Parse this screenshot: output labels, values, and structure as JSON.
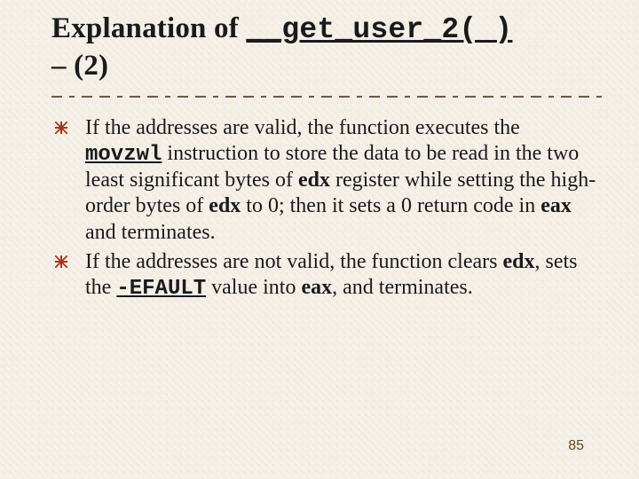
{
  "title": {
    "prefix": "Explanation of ",
    "code": "__get_user_2( )",
    "suffix1": "–",
    "suffix2": "(2)"
  },
  "bullets": [
    {
      "t1": "If the addresses are valid, the function executes the ",
      "code1": "movzwl",
      "t2": " instruction to store the data to be read in the two least significant bytes of ",
      "reg1": "edx",
      "t3": " register while setting the high-order bytes of ",
      "reg2": "edx",
      "t4": " to 0; then it sets a 0 return code in ",
      "reg3": "eax",
      "t5": " and terminates."
    },
    {
      "t1": "If the addresses are not valid, the function clears ",
      "reg1": "edx",
      "t2": ", sets the ",
      "code1": "-EFAULT",
      "t3": " value into ",
      "reg2": "eax",
      "t4": ", and terminates."
    }
  ],
  "page_number": "85"
}
